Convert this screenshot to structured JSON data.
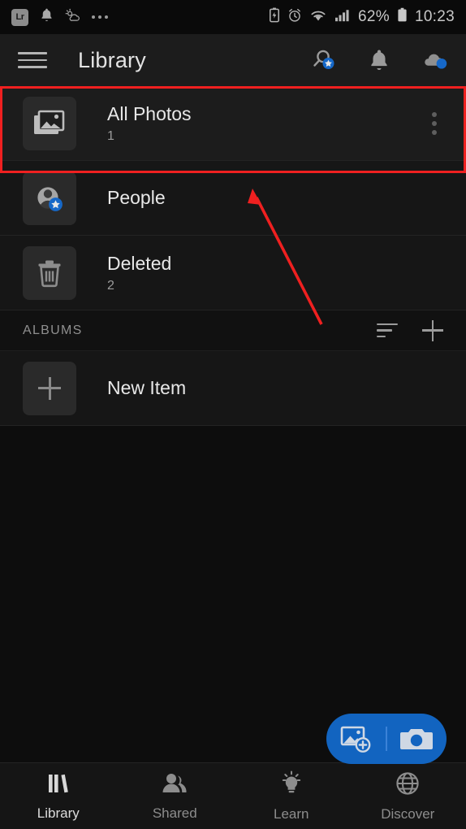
{
  "status_bar": {
    "app_badge": "Lr",
    "left_icons": [
      "lightroom-badge",
      "notification-bell-icon",
      "weather-icon",
      "more-dots-icon"
    ],
    "right_icons": [
      "battery-saver-icon",
      "alarm-icon",
      "wifi-icon",
      "signal-icon"
    ],
    "battery_percent": "62%",
    "time": "10:23"
  },
  "header": {
    "menu_icon": "hamburger-menu-icon",
    "title": "Library",
    "actions": [
      {
        "name": "search-icon",
        "badge": "star"
      },
      {
        "name": "notifications-bell-icon",
        "badge": ""
      },
      {
        "name": "cloud-sync-icon",
        "badge": "dot"
      }
    ]
  },
  "library_rows": [
    {
      "title": "All Photos",
      "count": "1",
      "icon": "photos-stack-icon",
      "highlighted": true,
      "has_overflow": true
    },
    {
      "title": "People",
      "count": "",
      "icon": "person-star-icon",
      "highlighted": false,
      "has_overflow": false
    },
    {
      "title": "Deleted",
      "count": "2",
      "icon": "trash-icon",
      "highlighted": false,
      "has_overflow": false
    }
  ],
  "albums": {
    "section_label": "ALBUMS",
    "sort_icon": "sort-icon",
    "add_icon": "add-album-icon",
    "items": [
      {
        "title": "New Item",
        "icon": "plus-icon"
      }
    ]
  },
  "fab": {
    "add_photo_icon": "add-photo-icon",
    "camera_icon": "camera-icon"
  },
  "bottom_nav": [
    {
      "label": "Library",
      "icon": "books-icon",
      "active": true
    },
    {
      "label": "Shared",
      "icon": "people-icon",
      "active": false
    },
    {
      "label": "Learn",
      "icon": "lightbulb-icon",
      "active": false
    },
    {
      "label": "Discover",
      "icon": "globe-icon",
      "active": false
    }
  ],
  "annotations": {
    "highlight_color": "#ef2020",
    "arrow_color": "#ef2020",
    "arrow_target": "All Photos row"
  },
  "colors": {
    "accent_blue": "#1264c0",
    "badge_blue": "#1668c8",
    "background": "#0d0d0d",
    "row_background": "#161616"
  }
}
